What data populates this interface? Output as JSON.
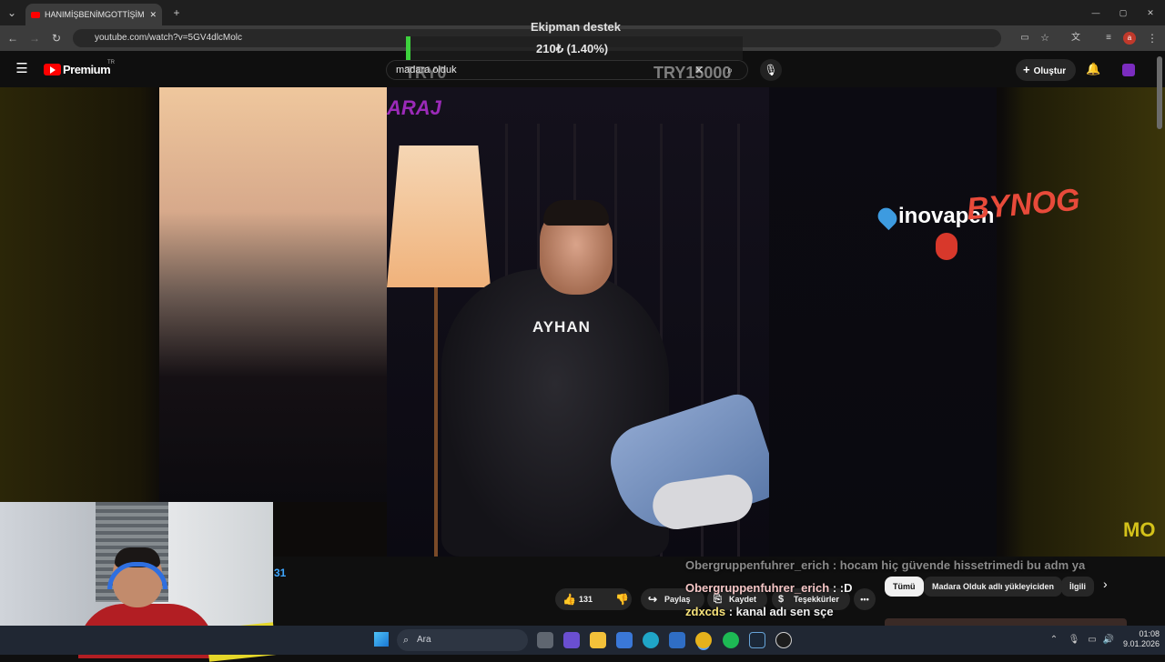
{
  "browser": {
    "tab_title": "HANIMİŞBENİMGOTTİŞİM | Ma",
    "url": "youtube.com/watch?v=5GV4dlcMolc"
  },
  "youtube": {
    "logo_text": "Premium",
    "logo_region": "TR",
    "search_value": "madara olduk",
    "create_label": "Oluştur"
  },
  "overlay": {
    "donation_title": "Ekipman destek",
    "donation_value": "210₺ (1.40%)",
    "donation_progress_percent": 1.4,
    "donation_left": "TRY0",
    "donation_right": "TRY15000"
  },
  "video": {
    "name_tag": "AYHAN",
    "top_text": "ARAJ",
    "sponsor": "inovapen",
    "brand_overlay": "BYNOG",
    "watermark": "MO",
    "side_number": "31"
  },
  "actions": {
    "like_count": "131",
    "share_label": "Paylaş",
    "save_label": "Kaydet",
    "thanks_label": "Teşekkürler",
    "more_label": "•••"
  },
  "chat": [
    {
      "user": "Obergruppenfuhrer_erich",
      "message": "hocam hiç güvende hissetrimedi bu adm ya"
    },
    {
      "user": "Obergruppenfuhrer_erich",
      "message": ":D"
    },
    {
      "user": "zdxcds",
      "message": "kanal adı sen sçe"
    }
  ],
  "chips": {
    "all": "Tümü",
    "uploader": "Madara Olduk adlı yükleyiciden",
    "related": "İlgili"
  },
  "taskbar": {
    "search_placeholder": "Ara",
    "time": "01:08",
    "date": "9.01.2026"
  },
  "colors": {
    "youtube_red": "#ff0000",
    "progress_green": "#3dd13d",
    "link_blue": "#3ea6ff"
  }
}
